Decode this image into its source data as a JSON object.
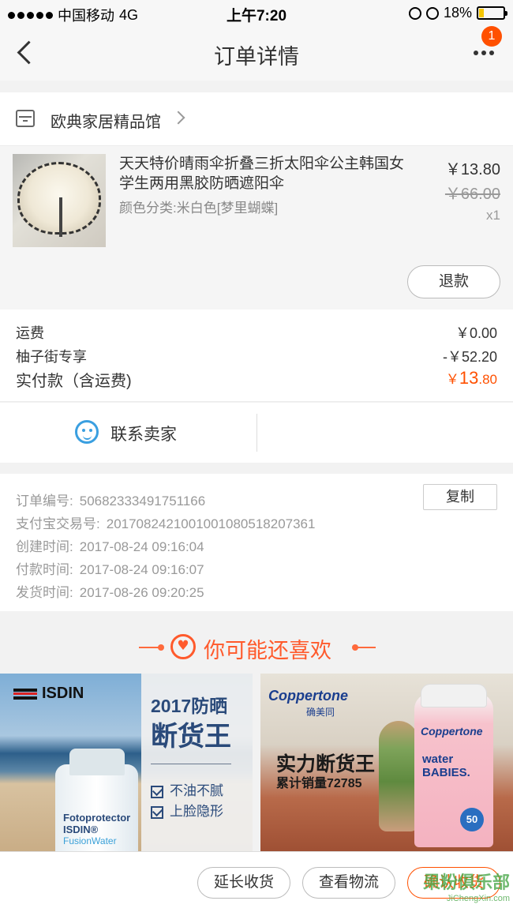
{
  "status_bar": {
    "carrier": "中国移动",
    "network": "4G",
    "time": "上午7:20",
    "battery": "18%",
    "battery_level": 0.18
  },
  "nav": {
    "title": "订单详情",
    "badge": "1"
  },
  "shop": {
    "name": "欧典家居精品馆"
  },
  "item": {
    "title": "天天特价晴雨伞折叠三折太阳伞公主韩国女学生两用黑胶防晒遮阳伞",
    "sku": "颜色分类:米白色[梦里蝴蝶]",
    "price": "￥13.80",
    "original_price": "￥66.00",
    "quantity": "x1",
    "refund_label": "退款"
  },
  "payment": {
    "shipping_label": "运费",
    "shipping_value": "￥0.00",
    "discount_label": "柚子街专享",
    "discount_value": "-￥52.20",
    "total_label": "实付款（含运费)",
    "total_currency": "￥",
    "total_int": "13",
    "total_dec": ".80"
  },
  "contact": {
    "label": "联系卖家"
  },
  "order_info": {
    "copy_label": "复制",
    "rows": [
      {
        "label": "订单编号:",
        "value": "50682333491751166"
      },
      {
        "label": "支付宝交易号:",
        "value": "2017082421001001080518207361"
      },
      {
        "label": "创建时间:",
        "value": "2017-08-24 09:16:04"
      },
      {
        "label": "付款时间:",
        "value": "2017-08-24 09:16:07"
      },
      {
        "label": "发货时间:",
        "value": "2017-08-26 09:20:25"
      }
    ]
  },
  "recommend": {
    "title": "你可能还喜欢",
    "ad1": {
      "brand": "ISDIN",
      "line1": "2017防晒",
      "line2": "断货王",
      "bullet1": "不油不腻",
      "bullet2": "上脸隐形",
      "product_line1": "Fotoprotector",
      "product_line2": "ISDIN®",
      "product_line3": "FusionWater"
    },
    "ad2": {
      "brand": "Coppertone",
      "brand_cn": "确美同",
      "line1": "实力断货王",
      "line2": "累计销量72785",
      "bottle_brand": "Coppertone",
      "bottle_line1": "water",
      "bottle_line2": "BABIES.",
      "spf": "50"
    }
  },
  "toolbar": {
    "extend_label": "延长收货",
    "logistics_label": "查看物流",
    "confirm_label": "确认收货"
  },
  "watermark": {
    "text": "果粉俱乐部",
    "url": "JiChengXin.com"
  },
  "colors": {
    "accent": "#ff5000",
    "contact_blue": "#3a9fe0"
  }
}
